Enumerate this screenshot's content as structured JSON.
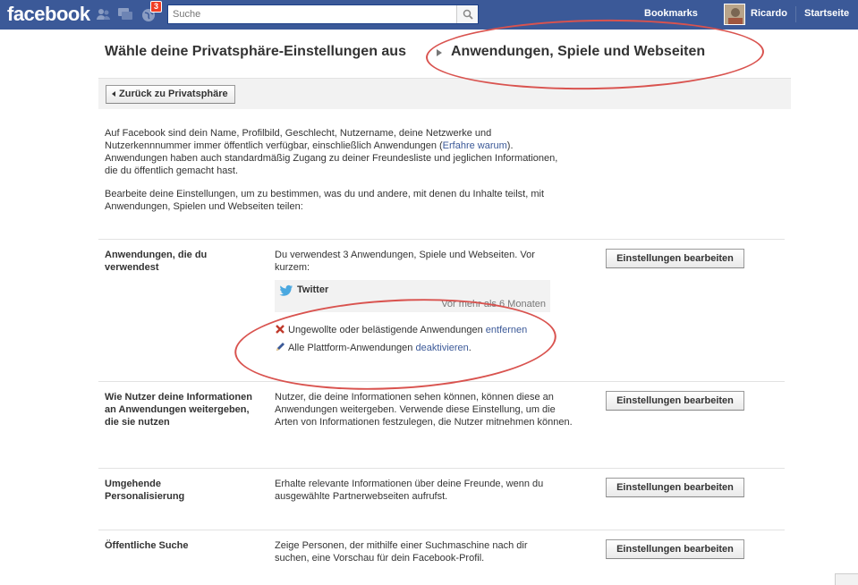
{
  "topbar": {
    "logo": "facebook",
    "notification_count": "3",
    "search_placeholder": "Suche",
    "bookmarks": "Bookmarks",
    "user_name": "Ricardo",
    "home": "Startseite"
  },
  "breadcrumb": {
    "parent": "Wähle deine Privatsphäre-Einstellungen aus",
    "current": "Anwendungen, Spiele und Webseiten"
  },
  "back_button": "Zurück zu Privatsphäre",
  "intro": {
    "p1_before": "Auf Facebook sind dein Name, Profilbild, Geschlecht, Nutzername, deine Netzwerke und Nutzerkennnummer immer öffentlich verfügbar, einschließlich Anwendungen (",
    "p1_link": "Erfahre warum",
    "p1_after": "). Anwendungen haben auch standardmäßig Zugang zu deiner Freundesliste und jeglichen Informationen, die du öffentlich gemacht hast.",
    "p2": "Bearbeite deine Einstellungen, um zu bestimmen, was du und andere, mit denen du Inhalte teilst, mit Anwendungen, Spielen und Webseiten teilen:"
  },
  "sections": [
    {
      "label": "Anwendungen, die du verwendest",
      "text": "Du verwendest 3 Anwendungen, Spiele und Webseiten. Vor kurzem:",
      "button": "Einstellungen bearbeiten"
    },
    {
      "label": "Wie Nutzer deine Informationen an Anwendungen weitergeben, die sie nutzen",
      "text": "Nutzer, die deine Informationen sehen können, können diese an Anwendungen weitergeben. Verwende diese Einstellung, um die Arten von Informationen festzulegen, die Nutzer mitnehmen können.",
      "button": "Einstellungen bearbeiten"
    },
    {
      "label": "Umgehende Personalisierung",
      "text": "Erhalte relevante Informationen über deine Freunde, wenn du ausgewählte Partnerwebseiten aufrufst.",
      "button": "Einstellungen bearbeiten"
    },
    {
      "label": "Öffentliche Suche",
      "text": "Zeige Personen, der mithilfe einer Suchmaschine nach dir suchen, eine Vorschau für dein Facebook-Profil.",
      "button": "Einstellungen bearbeiten"
    }
  ],
  "recent_app": {
    "name": "Twitter",
    "time": "Vor mehr als 6 Monaten"
  },
  "actions": {
    "remove_text": "Ungewollte oder belästigende Anwendungen ",
    "remove_link": "entfernen",
    "disable_text": "Alle Plattform-Anwendungen ",
    "disable_link": "deaktivieren",
    "disable_after": "."
  },
  "colors": {
    "brand": "#3b5998",
    "annotation": "#d9534f"
  }
}
